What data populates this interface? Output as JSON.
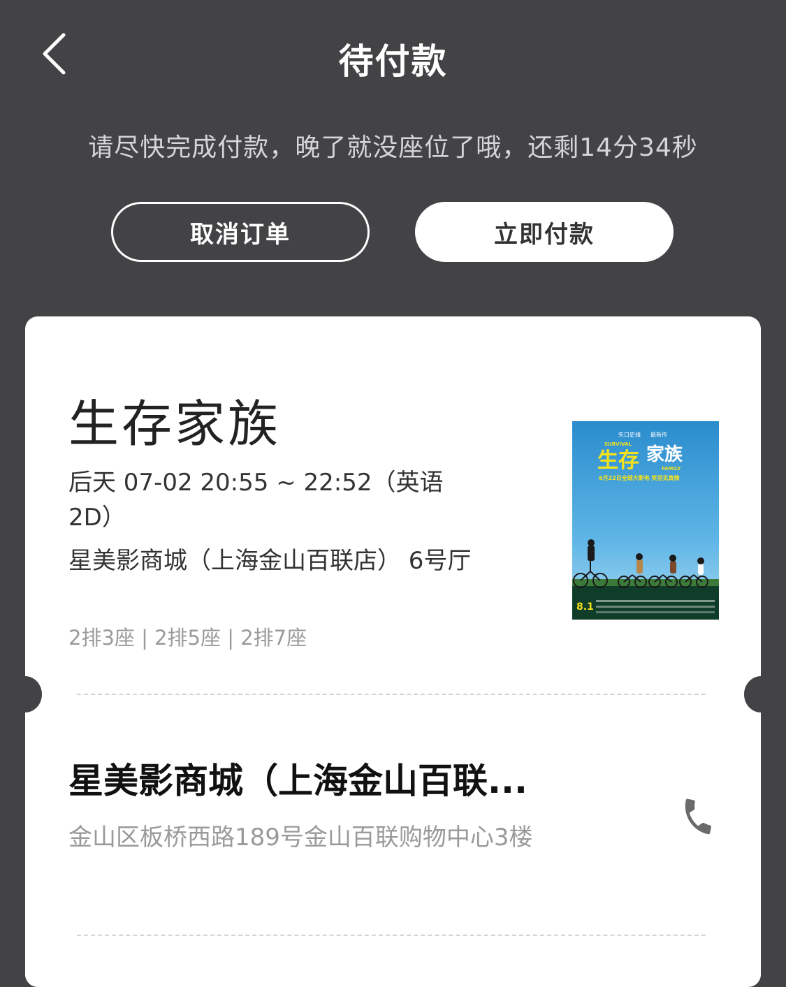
{
  "header": {
    "title": "待付款"
  },
  "notice": "请尽快完成付款，晚了就没座位了哦，还剩14分34秒",
  "actions": {
    "cancel_label": "取消订单",
    "pay_label": "立即付款"
  },
  "movie": {
    "title": "生存家族",
    "showtime": "后天 07-02 20:55 ~ 22:52（英语2D）",
    "hall": "星美影商城（上海金山百联店） 6号厅",
    "seats": "2排3座 | 2排5座 | 2排7座",
    "poster": {
      "line1": "矢口史靖",
      "line1b": "最新作",
      "survival": "SURVIVAL",
      "title_left": "生存",
      "title_right": "家族",
      "family": "FAMILY",
      "tagline": "6月22日全球大断电 笑泪见真情",
      "date": "8.1"
    }
  },
  "cinema": {
    "name": "星美影商城（上海金山百联...",
    "address": "金山区板桥西路189号金山百联购物中心3楼"
  },
  "colors": {
    "header_bg": "#434346",
    "card_bg": "#ffffff",
    "poster_sky": "#2f8fcf",
    "poster_yellow": "#f5e21c"
  },
  "icons": {
    "back": "chevron-left-icon",
    "phone": "phone-icon"
  }
}
